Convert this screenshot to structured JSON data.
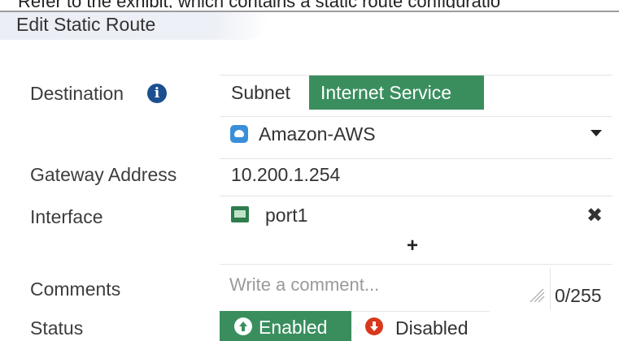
{
  "caption": "Refer to the exhibit, which contains a static route configuratio",
  "dialog": {
    "title": "Edit Static Route"
  },
  "destination": {
    "label": "Destination",
    "info_icon": "info-icon",
    "types": [
      "Subnet",
      "Internet Service"
    ],
    "selected_type": "Internet Service",
    "service": "Amazon-AWS",
    "service_icon": "cloud-icon"
  },
  "gateway": {
    "label": "Gateway Address",
    "value": "10.200.1.254"
  },
  "interface": {
    "label": "Interface",
    "value": "port1",
    "port_icon": "network-port-icon",
    "remove_icon": "close-icon",
    "add_icon": "plus-icon",
    "add_label": "+"
  },
  "comments": {
    "label": "Comments",
    "placeholder": "Write a comment...",
    "counter": "0/255"
  },
  "status": {
    "label": "Status",
    "enabled": "Enabled",
    "disabled": "Disabled",
    "selected": "Enabled"
  },
  "colors": {
    "accent_green": "#3a8e5e",
    "disabled_red": "#d9381e",
    "info_blue": "#1b4f8f",
    "aws_blue": "#3a8fd9"
  }
}
